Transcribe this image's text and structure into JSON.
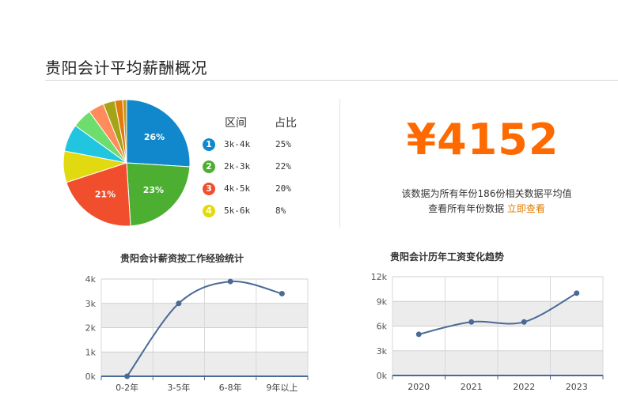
{
  "page_title": "贵阳会计平均薪酬概况",
  "legend": {
    "header_range": "区间",
    "header_share": "占比",
    "items": [
      {
        "num": "1",
        "range": "3k-4k",
        "share": "25%",
        "color": "#1188cc"
      },
      {
        "num": "2",
        "range": "2k-3k",
        "share": "22%",
        "color": "#4caf32"
      },
      {
        "num": "3",
        "range": "4k-5k",
        "share": "20%",
        "color": "#f04e2c"
      },
      {
        "num": "4",
        "range": "5k-6k",
        "share": "8%",
        "color": "#e2da10"
      }
    ]
  },
  "average": {
    "value": "¥4152",
    "note_line1": "该数据为所有年份186份相关数据平均值",
    "note_line2_prefix": "查看所有年份数据",
    "note_link": "立即查看"
  },
  "chart_data": [
    {
      "type": "pie",
      "slices": [
        {
          "value": 26,
          "label": "26%",
          "color": "#1188cc"
        },
        {
          "value": 23,
          "label": "23%",
          "color": "#4caf32"
        },
        {
          "value": 21,
          "label": "21%",
          "color": "#f04e2c"
        },
        {
          "value": 8,
          "label": "",
          "color": "#e2da10"
        },
        {
          "value": 7,
          "label": "",
          "color": "#22c5e0"
        },
        {
          "value": 5,
          "label": "",
          "color": "#6dde6d"
        },
        {
          "value": 4,
          "label": "",
          "color": "#ff8c5a"
        },
        {
          "value": 3,
          "label": "",
          "color": "#a4a416"
        },
        {
          "value": 2,
          "label": "",
          "color": "#e27a0c"
        },
        {
          "value": 1,
          "label": "",
          "color": "#c79810"
        }
      ]
    },
    {
      "type": "line",
      "title": "贵阳会计薪资按工作经验统计",
      "categories": [
        "0-2年",
        "3-5年",
        "6-8年",
        "9年以上"
      ],
      "values": [
        0,
        3000,
        3900,
        3400
      ],
      "ylim": [
        0,
        4000
      ],
      "yticks": [
        "0k",
        "1k",
        "2k",
        "3k",
        "4k"
      ],
      "line_color": "#4a6a96",
      "grid": true
    },
    {
      "type": "line",
      "title": "贵阳会计历年工资变化趋势",
      "categories": [
        "2020",
        "2021",
        "2022",
        "2023"
      ],
      "values": [
        5000,
        6500,
        6500,
        10000
      ],
      "ylim": [
        0,
        12000
      ],
      "yticks": [
        "0k",
        "3k",
        "6k",
        "9k",
        "12k"
      ],
      "line_color": "#4a6a96",
      "grid": true
    }
  ]
}
